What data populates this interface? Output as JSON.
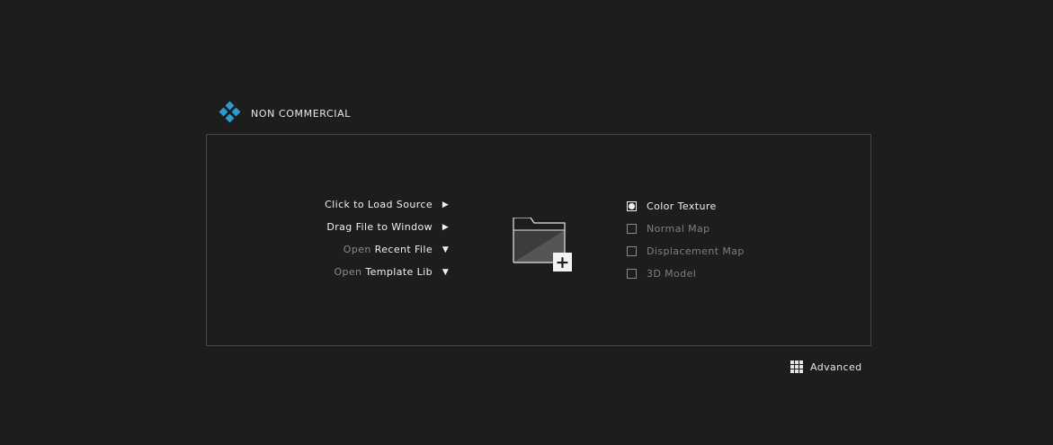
{
  "header": {
    "brand_text": "NON COMMERCIAL",
    "logo_icon": "diamond-cluster-icon",
    "accent_color": "#2b9bd1"
  },
  "actions": [
    {
      "prefix": "",
      "label": "Click to Load Source",
      "arrow": "▶"
    },
    {
      "prefix": "",
      "label": "Drag File to Window",
      "arrow": "▶"
    },
    {
      "prefix": "Open",
      "label": "Recent File",
      "arrow": "▼"
    },
    {
      "prefix": "Open",
      "label": "Template Lib",
      "arrow": "▼"
    }
  ],
  "folder": {
    "icon": "folder-add-icon",
    "plus": "+"
  },
  "options": [
    {
      "label": "Color Texture",
      "selected": true
    },
    {
      "label": "Normal Map",
      "selected": false
    },
    {
      "label": "Displacement Map",
      "selected": false
    },
    {
      "label": "3D Model",
      "selected": false
    }
  ],
  "footer": {
    "advanced_label": "Advanced",
    "advanced_icon": "grid-icon"
  }
}
